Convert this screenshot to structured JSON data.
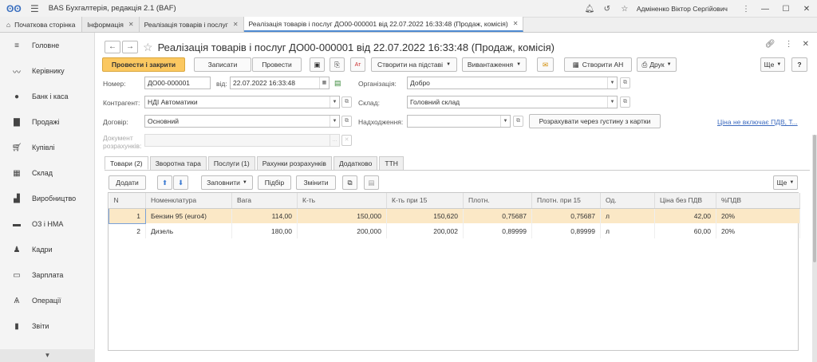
{
  "app": {
    "title": "BAS Бухгалтерія, редакція 2.1  (BAF)",
    "user": "Адміненко Віктор Сергійович"
  },
  "tabs": [
    {
      "label": "Початкова сторінка"
    },
    {
      "label": "Інформація"
    },
    {
      "label": "Реалізація товарів і послуг"
    },
    {
      "label": "Реалізація товарів і послуг ДО00-000001 від 22.07.2022 16:33:48 (Продаж, комісія)"
    }
  ],
  "sidebar": {
    "items": [
      {
        "label": "Головне",
        "icon": "menu-lines-icon"
      },
      {
        "label": "Керівнику",
        "icon": "trend-chart-icon"
      },
      {
        "label": "Банк і каса",
        "icon": "coin-icon"
      },
      {
        "label": "Продажі",
        "icon": "shopping-bag-icon"
      },
      {
        "label": "Купівлі",
        "icon": "cart-icon"
      },
      {
        "label": "Склад",
        "icon": "warehouse-grid-icon"
      },
      {
        "label": "Виробництво",
        "icon": "factory-icon"
      },
      {
        "label": "ОЗ і НМА",
        "icon": "truck-icon"
      },
      {
        "label": "Кадри",
        "icon": "person-icon"
      },
      {
        "label": "Зарплата",
        "icon": "money-icon"
      },
      {
        "label": "Операції",
        "icon": "operations-icon"
      },
      {
        "label": "Звіти",
        "icon": "bar-chart-icon"
      }
    ]
  },
  "doc": {
    "title": "Реалізація товарів і послуг ДО00-000001 від 22.07.2022 16:33:48 (Продаж, комісія)"
  },
  "toolbar": {
    "post_close": "Провести і закрити",
    "save": "Записати",
    "post": "Провести",
    "create_based": "Створити на підставі",
    "unload": "Вивантаження",
    "create_ah": "Створити АН",
    "print": "Друк",
    "more": "Ще",
    "help": "?"
  },
  "form": {
    "number_label": "Номер:",
    "number": "ДО00-000001",
    "date_label": "від:",
    "date": "22.07.2022 16:33:48",
    "org_label": "Організація:",
    "org": "Добро",
    "counterparty_label": "Контрагент:",
    "counterparty": "НДІ Автоматики",
    "warehouse_label": "Склад:",
    "warehouse": "Головний склад",
    "contract_label": "Договір:",
    "contract": "Основний",
    "receipt_label": "Надходження:",
    "receipt": "",
    "calc_density": "Розрахувати через густину з картки",
    "vat_link": "Ціна не включає ПДВ, Т...",
    "settlement_label": "Документ\nрозрахунків:"
  },
  "page_tabs": [
    "Товари (2)",
    "Зворотна тара",
    "Послуги (1)",
    "Рахунки розрахунків",
    "Додатково",
    "ТТН"
  ],
  "table_toolbar": {
    "add": "Додати",
    "fill": "Заповнити",
    "pick": "Підбір",
    "change": "Змінити",
    "more": "Ще"
  },
  "table": {
    "columns": [
      "N",
      "Номенклатура",
      "Вага",
      "К-ть",
      "К-ть при 15",
      "Плотн.",
      "Плотн. при 15",
      "Од.",
      "Ціна без ПДВ",
      "%ПДВ"
    ],
    "rows": [
      [
        "1",
        "Бензин 95 (euro4)",
        "114,00",
        "150,000",
        "150,620",
        "0,75687",
        "0,75687",
        "л",
        "42,00",
        "20%"
      ],
      [
        "2",
        "Дизель",
        "180,00",
        "200,000",
        "200,002",
        "0,89999",
        "0,89999",
        "л",
        "60,00",
        "20%"
      ]
    ]
  }
}
